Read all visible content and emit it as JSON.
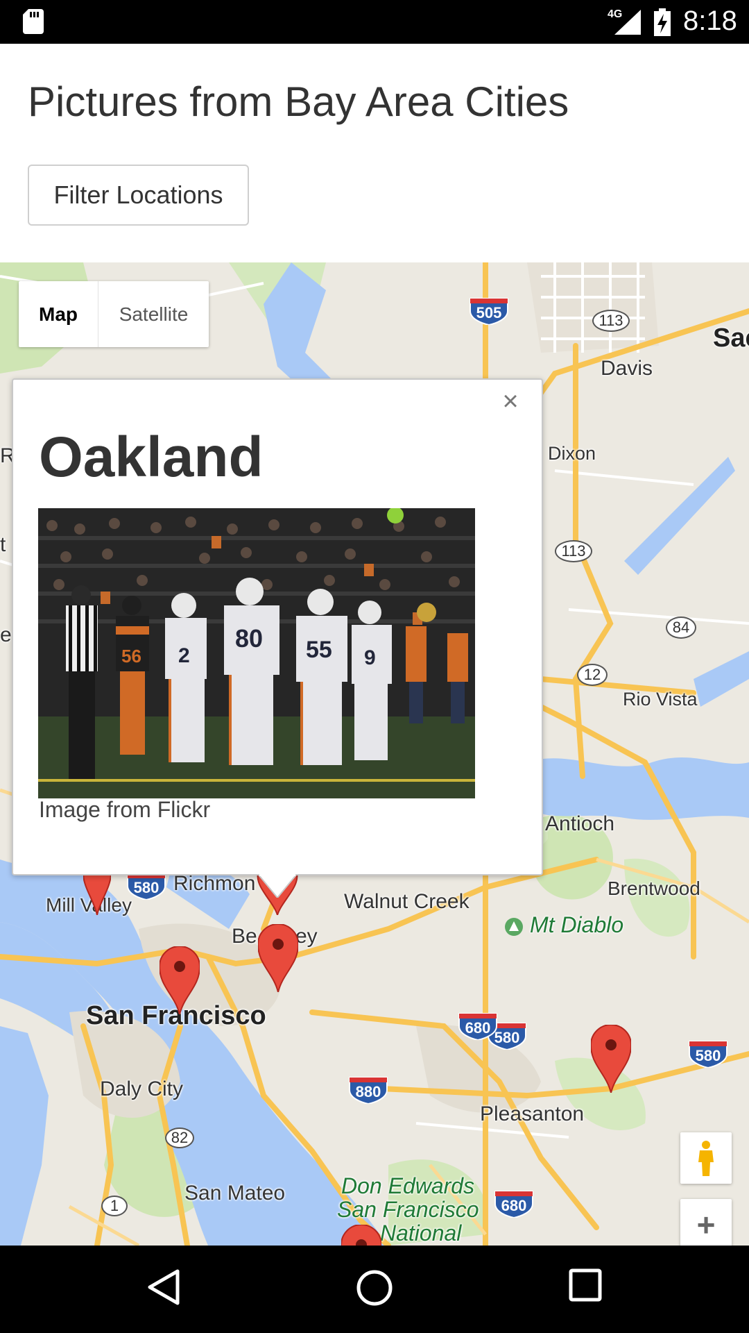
{
  "status_bar": {
    "time": "8:18",
    "network": "4G",
    "icons": [
      "sd-card-icon",
      "signal-icon",
      "battery-charging-icon"
    ]
  },
  "header": {
    "title": "Pictures from Bay Area Cities",
    "filter_button": "Filter Locations"
  },
  "map": {
    "map_type": {
      "active": "Map",
      "inactive": "Satellite"
    },
    "places": {
      "davis": "Davis",
      "sac": "Sac",
      "dixon": "Dixon",
      "rio_vista": "Rio Vista",
      "antioch": "Antioch",
      "brentwood": "Brentwood",
      "mt_diablo": "Mt Diablo",
      "walnut_creek": "Walnut Creek",
      "richmond": "Richmon",
      "berkeley_a": "Be",
      "berkeley_b": "ey",
      "mill_valley": "Mill Valley",
      "san_francisco": "San Francisco",
      "daly_city": "Daly City",
      "pleasanton": "Pleasanton",
      "san_mateo": "San Mateo",
      "don_edwards_1": "Don Edwards",
      "don_edwards_2": "San Francisco",
      "don_edwards_3": "National",
      "edge_ro": "Ro",
      "edge_t": "t",
      "edge_e": "e"
    },
    "routes": {
      "i505": "505",
      "i580_a": "580",
      "i580_b": "580",
      "i580_c": "580",
      "i680_a": "680",
      "i680_b": "680",
      "i880": "880",
      "sr113_a": "113",
      "sr113_b": "113",
      "sr84": "84",
      "sr12": "12",
      "sr82": "82",
      "sr1": "1"
    },
    "controls": {
      "pegman": "pegman-icon",
      "zoom_in": "+"
    },
    "info_window": {
      "title": "Oakland",
      "caption": "Image from Flickr",
      "close": "×",
      "photo_jerseys": [
        "2",
        "80",
        "55",
        "9",
        "56"
      ]
    }
  },
  "nav_bar": {
    "icons": [
      "back-icon",
      "home-icon",
      "recents-icon"
    ]
  }
}
